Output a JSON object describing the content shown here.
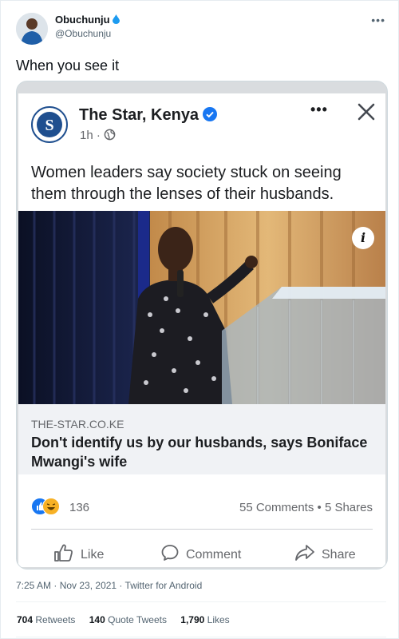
{
  "tweet": {
    "author_name": "Obuchunju",
    "author_handle": "@Obuchunju",
    "text": "When you see it",
    "time": "7:25 AM",
    "date": "Nov 23, 2021",
    "source": "Twitter for Android",
    "separator": " · ",
    "more_icon": "ellipsis-icon",
    "stats": {
      "retweets_count": "704",
      "retweets_label": "Retweets",
      "quotes_count": "140",
      "quotes_label": "Quote Tweets",
      "likes_count": "1,790",
      "likes_label": "Likes"
    }
  },
  "embedded_post": {
    "page_name": "The Star, Kenya",
    "logo_letter": "S",
    "time_ago": "1h",
    "time_separator": " · ",
    "text": "Women leaders say society stuck on seeing them through the lenses of their husbands.",
    "link_domain": "THE-STAR.CO.KE",
    "link_title": "Don't identify us by our husbands, says Boniface Mwangi's wife",
    "reaction_count": "136",
    "comments_label": "55 Comments",
    "stats_separator": " • ",
    "shares_label": "5 Shares",
    "actions": {
      "like": "Like",
      "comment": "Comment",
      "share": "Share"
    },
    "info_glyph": "i",
    "more_glyph": "•••"
  },
  "colors": {
    "brand_blue": "#1877f2",
    "twitter_blue": "#1d9bf0",
    "logo_navy": "#1f4f8f",
    "text_secondary": "#536471"
  }
}
